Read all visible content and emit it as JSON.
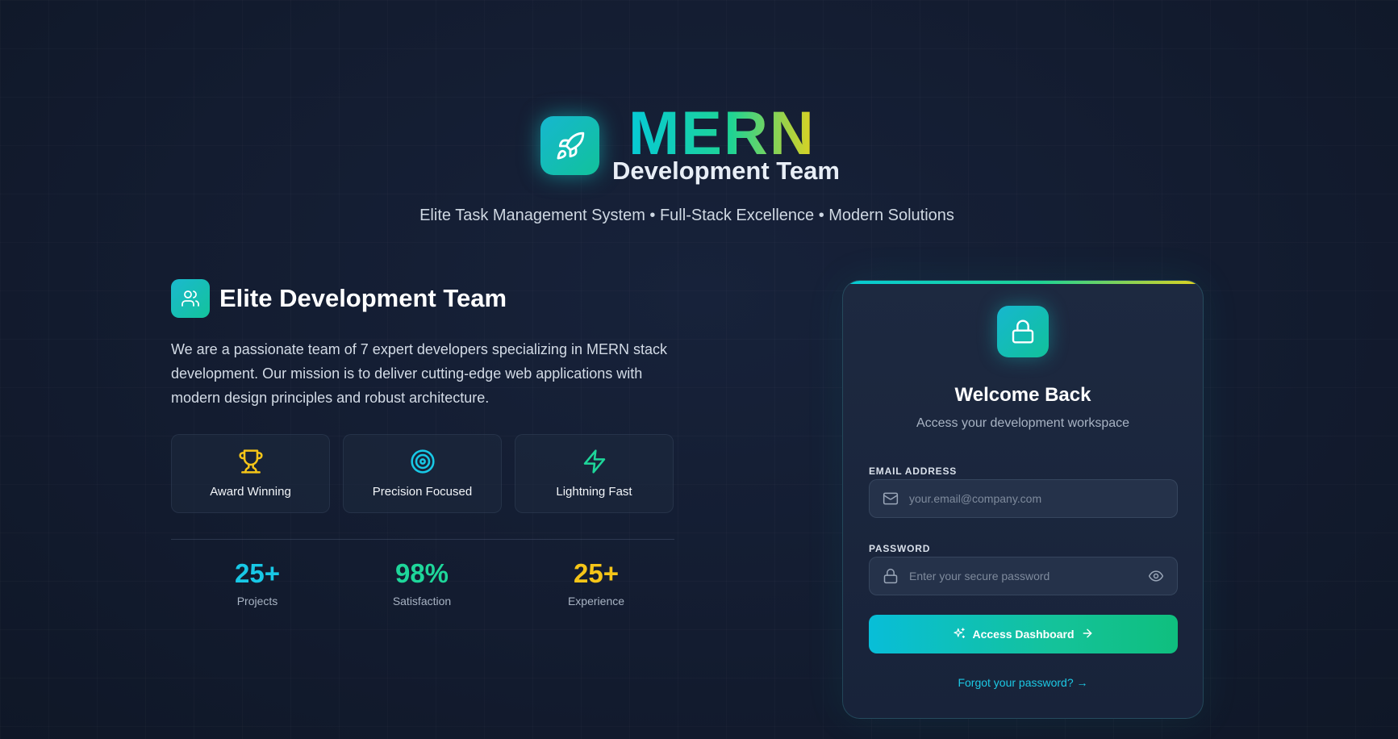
{
  "header": {
    "brand_main": "MERN",
    "brand_sub": "Development Team",
    "tagline": "Elite Task Management System • Full-Stack Excellence • Modern Solutions"
  },
  "team": {
    "title": "Elite Development Team",
    "description": "We are a passionate team of 7 expert developers specializing in MERN stack development. Our mission is to deliver cutting-edge web applications with modern design principles and robust architecture.",
    "features": [
      {
        "label": "Award Winning",
        "icon": "trophy-icon",
        "color": "#f5c518"
      },
      {
        "label": "Precision Focused",
        "icon": "target-icon",
        "color": "#18c8e6"
      },
      {
        "label": "Lightning Fast",
        "icon": "lightning-icon",
        "color": "#1ed69a"
      }
    ],
    "stats": [
      {
        "value": "25+",
        "label": "Projects",
        "color": "#18c8e6"
      },
      {
        "value": "98%",
        "label": "Satisfaction",
        "color": "#1ed69a"
      },
      {
        "value": "25+",
        "label": "Experience",
        "color": "#f5c518"
      }
    ]
  },
  "login": {
    "title": "Welcome Back",
    "subtitle": "Access your development workspace",
    "email_label": "EMAIL ADDRESS",
    "email_placeholder": "your.email@company.com",
    "email_value": "",
    "password_label": "PASSWORD",
    "password_placeholder": "Enter your secure password",
    "password_value": "",
    "submit_label": "Access Dashboard",
    "forgot_label": "Forgot your password? →"
  },
  "colors": {
    "accent_cyan": "#06c9d6",
    "accent_green": "#1fd394",
    "accent_yellow": "#e3d21e",
    "background": "#131c30",
    "card": "#1d2940"
  }
}
